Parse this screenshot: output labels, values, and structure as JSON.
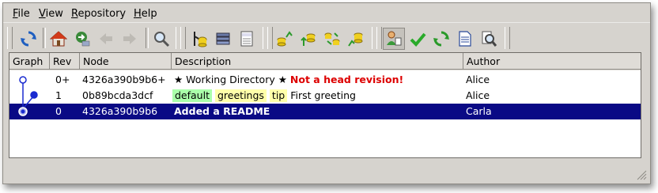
{
  "menu": [
    "File",
    "View",
    "Repository",
    "Help"
  ],
  "menu_mnemonics": [
    "F",
    "V",
    "R",
    "H"
  ],
  "toolbar": {
    "buttons": [
      "refresh-icon",
      "home-icon",
      "goto-icon",
      "back-icon",
      "forward-icon",
      "search-icon",
      "branch-icon",
      "stack-icon",
      "log-icon",
      "merge-icon",
      "yellow-cyl-up-icon",
      "yellow-cyl-swap-icon",
      "yellow-cyl-graph-icon",
      "user-filter-icon",
      "checkmark-icon",
      "sync-icon",
      "document-icon",
      "find-icon"
    ]
  },
  "table": {
    "columns": [
      "Graph",
      "Rev",
      "Node",
      "Description",
      "Author"
    ],
    "rows": [
      {
        "rev": "0+",
        "node": "4326a390b9b6+",
        "description": "★ Working Directory ★",
        "warning": "Not a head revision!",
        "tags": [],
        "author": "Alice",
        "selected": false
      },
      {
        "rev": "1",
        "node": "0b89bcda3dcf",
        "description": "First greeting",
        "warning": "",
        "tags": [
          {
            "text": "default",
            "color": "#aaffaa"
          },
          {
            "text": "greetings",
            "color": "#ffffaa"
          },
          {
            "text": "tip",
            "color": "#ffffaa"
          }
        ],
        "author": "Alice",
        "selected": false
      },
      {
        "rev": "0",
        "node": "4326a390b9b6",
        "description": "Added a README",
        "warning": "",
        "tags": [],
        "author": "Carla",
        "selected": true
      }
    ]
  },
  "colors": {
    "selection": "#0a0a85",
    "warning": "#dd0000",
    "branch_tag": "#aaffaa",
    "tag": "#ffffaa",
    "graph": "#1a2bd0"
  }
}
